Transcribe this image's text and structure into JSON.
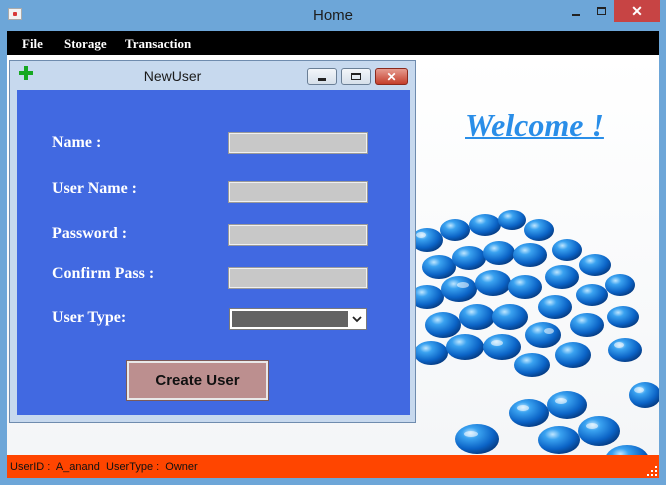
{
  "window": {
    "title": "Home",
    "close_glyph": "✕"
  },
  "menu": {
    "items": [
      {
        "label": "File"
      },
      {
        "label": "Storage"
      },
      {
        "label": "Transaction"
      }
    ]
  },
  "welcome_text": "Welcome !",
  "child_window": {
    "title": "NewUser",
    "close_glyph": "✕",
    "fields": [
      {
        "label": "Name :",
        "value": ""
      },
      {
        "label": "User Name :",
        "value": ""
      },
      {
        "label": "Password :",
        "value": ""
      },
      {
        "label": "Confirm Pass :",
        "value": ""
      }
    ],
    "user_type": {
      "label": "User Type:",
      "selected": ""
    },
    "create_button_label": "Create User"
  },
  "status_bar": {
    "text": "UserID :  A_anand  UserType :  Owner",
    "color": "#ff4500"
  },
  "colors": {
    "title_bar": "#6da6d8",
    "form_panel": "#4169e1",
    "welcome": "#2a8ee8",
    "button": "#bc8f8f"
  },
  "icons": [
    "app-icon",
    "minimize-icon",
    "maximize-icon",
    "close-icon",
    "add-user-icon",
    "chevron-down-icon",
    "resize-grip-icon"
  ]
}
